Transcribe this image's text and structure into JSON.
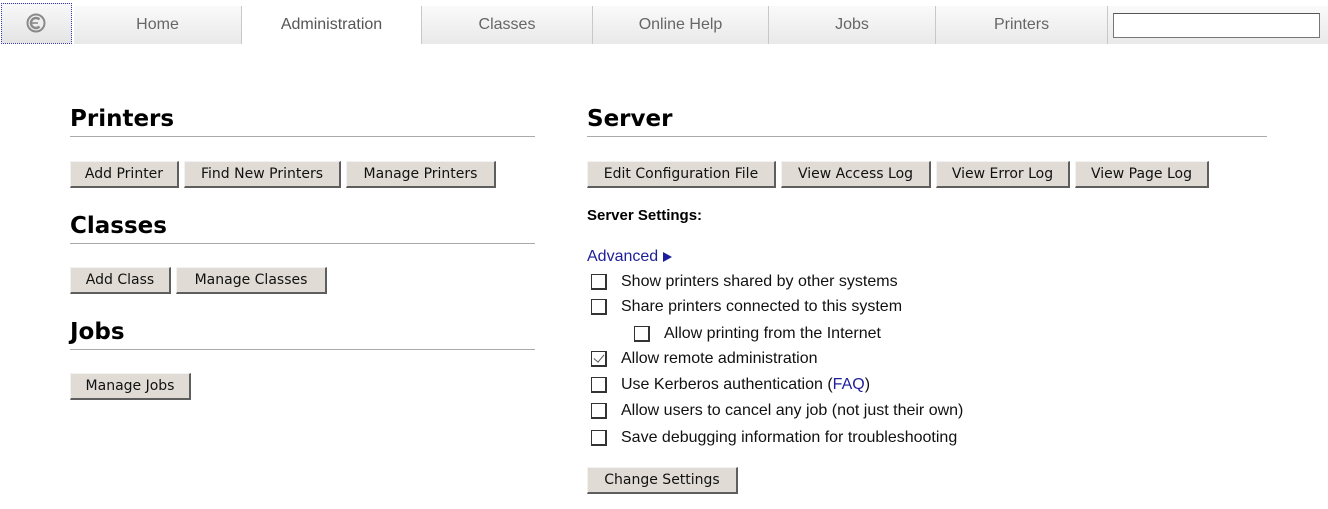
{
  "nav": {
    "tabs": [
      {
        "label": "Home"
      },
      {
        "label": "Administration"
      },
      {
        "label": "Classes"
      },
      {
        "label": "Online Help"
      },
      {
        "label": "Jobs"
      },
      {
        "label": "Printers"
      }
    ],
    "active_tab": "Administration",
    "search_value": ""
  },
  "printers": {
    "title": "Printers",
    "buttons": [
      "Add Printer",
      "Find New Printers",
      "Manage Printers"
    ]
  },
  "classes": {
    "title": "Classes",
    "buttons": [
      "Add Class",
      "Manage Classes"
    ]
  },
  "jobs": {
    "title": "Jobs",
    "buttons": [
      "Manage Jobs"
    ]
  },
  "server": {
    "title": "Server",
    "buttons": [
      "Edit Configuration File",
      "View Access Log",
      "View Error Log",
      "View Page Log"
    ],
    "settings_label": "Server Settings:",
    "advanced_label": "Advanced",
    "options": [
      {
        "label": "Show printers shared by other systems",
        "checked": false
      },
      {
        "label": "Share printers connected to this system",
        "checked": false
      },
      {
        "label": "Allow printing from the Internet",
        "checked": false
      },
      {
        "label": "Allow remote administration",
        "checked": true
      },
      {
        "label": "Use Kerberos authentication (",
        "link": "FAQ",
        "suffix": ")",
        "checked": false
      },
      {
        "label": "Allow users to cancel any job (not just their own)",
        "checked": false
      },
      {
        "label": "Save debugging information for troubleshooting",
        "checked": false
      }
    ],
    "submit_label": "Change Settings"
  },
  "colors": {
    "link": "#1e1e9a",
    "button_face": "#e0dcd5",
    "rule": "#aaaaaa"
  }
}
